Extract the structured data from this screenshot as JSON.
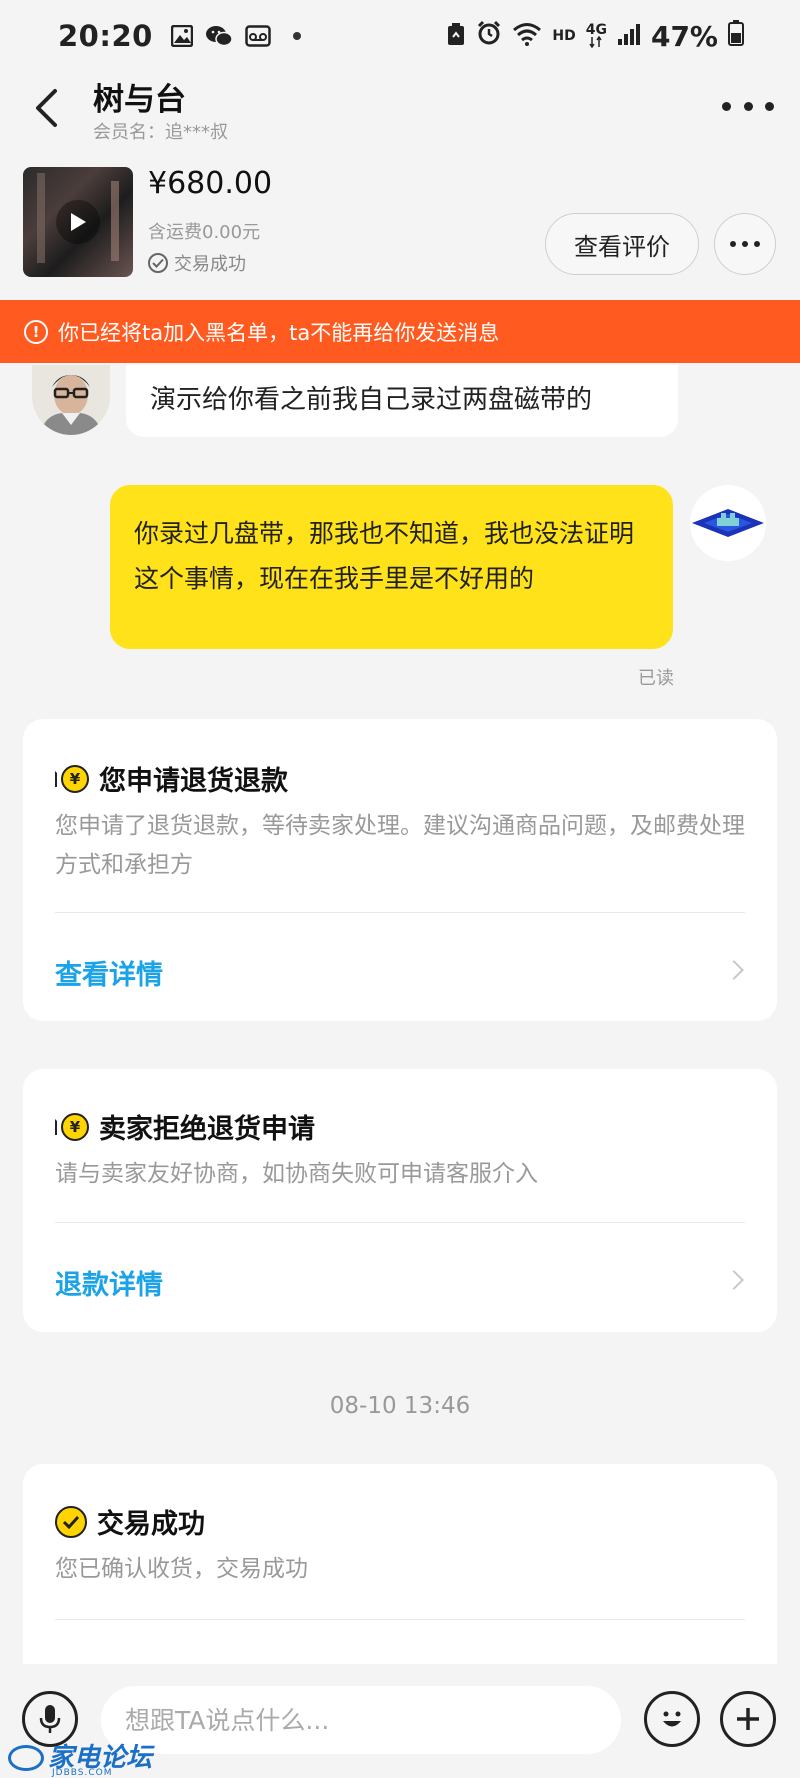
{
  "status_bar": {
    "time": "20:20",
    "icons": [
      "gallery-icon",
      "wechat-icon",
      "voicemail-icon",
      "notification-dot",
      "recycle-icon",
      "alarm-icon",
      "wifi-icon",
      "network-4g-icon",
      "signal-icon",
      "battery-icon"
    ],
    "hd_label": "HD",
    "network_label": "4G",
    "battery_percent": "47%"
  },
  "header": {
    "title": "树与台",
    "member_label": "会员名：追***叔"
  },
  "product": {
    "price": "¥680.00",
    "shipping": "含运费0.00元",
    "status": "交易成功",
    "review_button": "查看评价"
  },
  "banner": {
    "text": "你已经将ta加入黑名单，ta不能再给你发送消息",
    "color": "#ff5a1f"
  },
  "messages": [
    {
      "side": "left",
      "text": "演示给你看之前我自己录过两盘磁带的"
    },
    {
      "side": "right",
      "text": "你录过几盘带，那我也不知道，我也没法证明这个事情，现在在我手里是不好用的",
      "read_status": "已读",
      "color": "#ffe21a"
    }
  ],
  "cards": [
    {
      "title": "您申请退货退款",
      "desc": "您申请了退货退款，等待卖家处理。建议沟通商品问题，及邮费处理方式和承担方",
      "link": "查看详情",
      "icon": "yen-coin-icon"
    },
    {
      "title": "卖家拒绝退货申请",
      "desc": "请与卖家友好协商，如协商失败可申请客服介入",
      "link": "退款详情",
      "icon": "yen-coin-icon"
    }
  ],
  "timestamp": "08-10 13:46",
  "trade_card": {
    "title": "交易成功",
    "desc": "您已确认收货，交易成功",
    "icon": "check-circle-icon"
  },
  "input": {
    "placeholder": "想跟TA说点什么..."
  },
  "watermark": {
    "text": "家电论坛",
    "sub": "JDBBS.COM"
  },
  "colors": {
    "accent_link": "#1aa3e6",
    "brand_yellow": "#ffd400"
  }
}
